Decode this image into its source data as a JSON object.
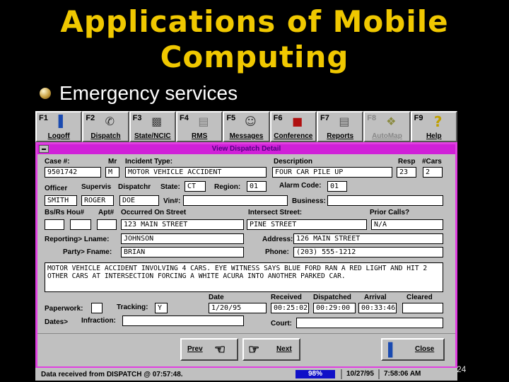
{
  "slide": {
    "title_line1": "Applications of Mobile",
    "title_line2": "Computing",
    "bullet": "Emergency  services",
    "page_number": "24"
  },
  "toolbar": [
    {
      "key": "F1",
      "label": "Logoff",
      "icon": "door-exit-icon"
    },
    {
      "key": "F2",
      "label": "Dispatch",
      "icon": "dispatch-radio-icon"
    },
    {
      "key": "F3",
      "label": "State/NCIC",
      "icon": "computer-terminal-icon"
    },
    {
      "key": "F4",
      "label": "RMS",
      "icon": "file-cabinet-icon"
    },
    {
      "key": "F5",
      "label": "Messages",
      "icon": "message-people-icon"
    },
    {
      "key": "F6",
      "label": "Conference",
      "icon": "conference-icon"
    },
    {
      "key": "F7",
      "label": "Reports",
      "icon": "reports-icon"
    },
    {
      "key": "F8",
      "label": "AutoMap",
      "icon": "map-icon"
    },
    {
      "key": "F9",
      "label": "Help",
      "icon": "help-question-icon"
    }
  ],
  "window": {
    "title": "View Dispatch Detail"
  },
  "form": {
    "case_label": "Case #:",
    "case_value": "9501742",
    "mr_label": "Mr",
    "mr_value": "M",
    "incident_label": "Incident Type:",
    "incident_value": "MOTOR VEHICLE ACCIDENT",
    "description_label": "Description",
    "description_value": "FOUR CAR PILE UP",
    "resp_label": "Resp",
    "resp_value": "23",
    "cars_label": "#Cars",
    "cars_value": "2",
    "officer_label": "Officer",
    "officer_value": "SMITH",
    "supervis_label": "Supervis",
    "supervis_value": "ROGER",
    "dispatchr_label": "Dispatchr",
    "dispatchr_value": "DOE",
    "state_label": "State:",
    "state_value": "CT",
    "region_label": "Region:",
    "region_value": "01",
    "alarm_label": "Alarm Code:",
    "alarm_value": "01",
    "vin_label": "Vin#:",
    "vin_value": "",
    "business_label": "Business:",
    "business_value": "",
    "bsrs_label": "Bs/Rs Hou#",
    "bsrs_value": "",
    "apt_label": "Apt#",
    "apt_value": "",
    "occurred_label": "Occurred On Street",
    "occurred_value": "123 MAIN STREET",
    "intersect_label": "Intersect Street:",
    "intersect_value": "PINE STREET",
    "prior_label": "Prior Calls?",
    "prior_value": "N/A",
    "reporting_label": "Reporting> Lname:",
    "lname_value": "JOHNSON",
    "address_label": "Address:",
    "address_value": "126 MAIN STREET",
    "party_label": "Party> Fname:",
    "fname_value": "BRIAN",
    "phone_label": "Phone:",
    "phone_value": "(203) 555-1212",
    "narrative": "MOTOR VEHICLE ACCIDENT INVOLVING 4 CARS. EYE WITNESS SAYS BLUE FORD RAN A RED LIGHT AND HIT 2 OTHER CARS AT INTERSECTION FORCING A WHITE ACURA INTO ANOTHER PARKED CAR.",
    "date_label": "Date",
    "date_value": "1/20/95",
    "received_label": "Received",
    "received_value": "00:25:02",
    "dispatched_label": "Dispatched",
    "dispatched_value": "00:29:00",
    "arrival_label": "Arrival",
    "arrival_value": "00:33:46",
    "cleared_label": "Cleared",
    "cleared_value": "",
    "paperwork_label": "Paperwork:",
    "paperwork_value": "",
    "tracking_label": "Tracking:",
    "tracking_value": "Y",
    "dates_label": "Dates>",
    "infraction_label": "Infraction:",
    "infraction_value": "",
    "court_label": "Court:",
    "court_value": ""
  },
  "buttons": {
    "prev": "Prev",
    "next": "Next",
    "close": "Close"
  },
  "status": {
    "message": "Data received from DISPATCH @ 07:57:48.",
    "percent": "98%",
    "date": "10/27/95",
    "time": "7:58:06 AM"
  }
}
